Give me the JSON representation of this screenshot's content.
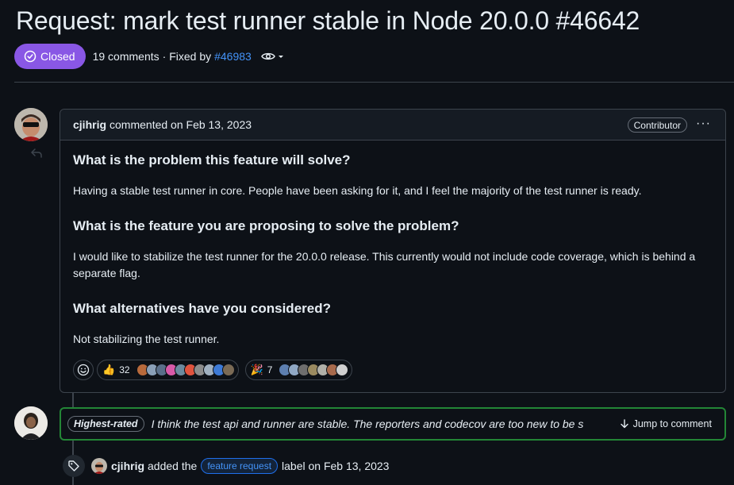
{
  "issue": {
    "title": "Request: mark test runner stable in Node 20.0.0 #46642",
    "state": "Closed",
    "comments": "19 comments",
    "fixed_by_prefix": "· Fixed by",
    "fixed_by_link": "#46983"
  },
  "comment": {
    "author": "cjihrig",
    "meta": "commented on Feb 13, 2023",
    "role": "Contributor",
    "more": "···",
    "sections": [
      {
        "heading": "What is the problem this feature will solve?",
        "text": "Having a stable test runner in core. People have been asking for it, and I feel the majority of the test runner is ready."
      },
      {
        "heading": "What is the feature you are proposing to solve the problem?",
        "text": "I would like to stabilize the test runner for the 20.0.0 release. This currently would not include code coverage, which is behind a separate flag."
      },
      {
        "heading": "What alternatives have you considered?",
        "text": "Not stabilizing the test runner."
      }
    ],
    "reactions": [
      {
        "emoji": "👍",
        "count": "32"
      },
      {
        "emoji": "🎉",
        "count": "7"
      }
    ]
  },
  "highlight": {
    "badge": "Highest-rated",
    "text": "I think the test api and runner are stable. The reporters and codecov are too new to be s",
    "jump": "Jump to comment"
  },
  "event": {
    "author": "cjihrig",
    "action": "added the",
    "label": "feature request",
    "suffix": "label on Feb 13, 2023"
  },
  "colors": {
    "closed": "#8957e5",
    "link": "#4493f8",
    "highlight_border": "#238636",
    "background": "#0d1117"
  },
  "icons": [
    "issue-closed-icon",
    "eye-icon",
    "reply-icon",
    "smiley-icon",
    "arrow-down-icon",
    "tag-icon"
  ]
}
